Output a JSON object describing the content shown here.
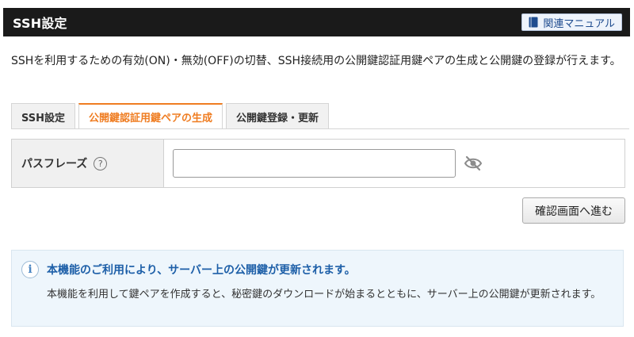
{
  "header": {
    "title": "SSH設定",
    "manual_button": "関連マニュアル"
  },
  "description": "SSHを利用するための有効(ON)・無効(OFF)の切替、SSH接続用の公開鍵認証用鍵ペアの生成と公開鍵の登録が行えます。",
  "tabs": [
    {
      "label": "SSH設定",
      "active": false
    },
    {
      "label": "公開鍵認証用鍵ペアの生成",
      "active": true
    },
    {
      "label": "公開鍵登録・更新",
      "active": false
    }
  ],
  "form": {
    "passphrase_label": "パスフレーズ",
    "help_symbol": "?",
    "passphrase_value": "",
    "passphrase_placeholder": ""
  },
  "confirm_button": "確認画面へ進む",
  "info": {
    "icon_glyph": "i",
    "title": "本機能のご利用により、サーバー上の公開鍵が更新されます。",
    "body": "本機能を利用して鍵ペアを作成すると、秘密鍵のダウンロードが始まるとともに、サーバー上の公開鍵が更新されます。"
  },
  "colors": {
    "header_bg": "#1a1a1a",
    "active_tab": "#ef7d22",
    "info_title": "#1d5fa8",
    "info_bg": "#eef6fc"
  },
  "icons": {
    "manual": "book-icon",
    "help": "question-circle-icon",
    "visibility": "eye-slash-icon",
    "info": "info-circle-icon"
  }
}
